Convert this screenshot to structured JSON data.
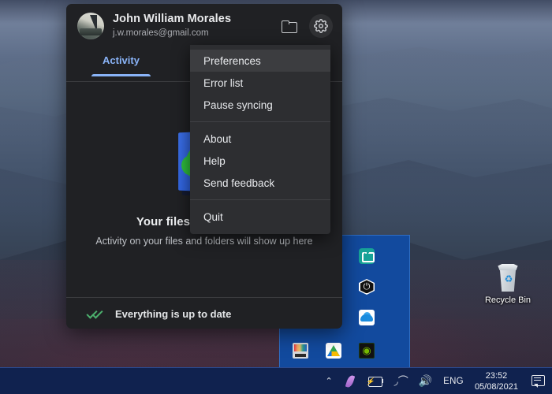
{
  "desktop": {
    "recycle_bin": {
      "label": "Recycle Bin",
      "icon": "recycle-bin-icon"
    }
  },
  "sync_panel": {
    "account": {
      "name": "John William Morales",
      "email": "j.w.morales@gmail.com",
      "avatar_icon": "user-avatar"
    },
    "header_actions": [
      {
        "name": "open-folder",
        "icon": "folder-icon"
      },
      {
        "name": "settings",
        "icon": "gear-icon"
      }
    ],
    "tabs": [
      {
        "label": "Activity",
        "selected": true
      }
    ],
    "empty_state": {
      "illustration": "cloud-check-icon",
      "title": "Your files are up to date",
      "subtitle": "Activity on your files and folders will show up here"
    },
    "status_bar": {
      "icon": "double-check-icon",
      "text": "Everything is up to date"
    }
  },
  "context_menu": {
    "groups": [
      [
        {
          "label": "Preferences",
          "selected": true
        },
        {
          "label": "Error list",
          "selected": false
        },
        {
          "label": "Pause syncing",
          "selected": false
        }
      ],
      [
        {
          "label": "About",
          "selected": false
        },
        {
          "label": "Help",
          "selected": false
        },
        {
          "label": "Send feedback",
          "selected": false
        }
      ],
      [
        {
          "label": "Quit",
          "selected": false
        }
      ]
    ]
  },
  "tray_overflow": {
    "icons": [
      {
        "name": "windows-defender-icon"
      },
      {
        "name": "remote-desktop-icon"
      },
      {
        "name": "bluetooth-icon"
      },
      {
        "name": "power-icon"
      },
      {
        "name": "key-icon"
      },
      {
        "name": "onedrive-cloud-icon"
      }
    ],
    "pinned": [
      {
        "name": "color-display-icon"
      },
      {
        "name": "google-drive-icon"
      },
      {
        "name": "nvidia-icon"
      }
    ]
  },
  "taskbar": {
    "show_hidden_icons": "⌃",
    "items": [
      {
        "name": "feather-icon"
      },
      {
        "name": "battery-icon"
      },
      {
        "name": "wifi-icon"
      },
      {
        "name": "volume-icon"
      }
    ],
    "language": "ENG",
    "clock": {
      "time": "23:52",
      "date": "05/08/2021"
    },
    "notifications_icon": "notification-center-icon"
  },
  "colors": {
    "panel_bg": "#202124",
    "menu_bg": "#2d2e31",
    "menu_selected": "#3c3d40",
    "accent_blue": "#8ab4f8",
    "status_green": "#4caf6d",
    "tray_blue": "#124a9e",
    "taskbar": "#10224f"
  }
}
